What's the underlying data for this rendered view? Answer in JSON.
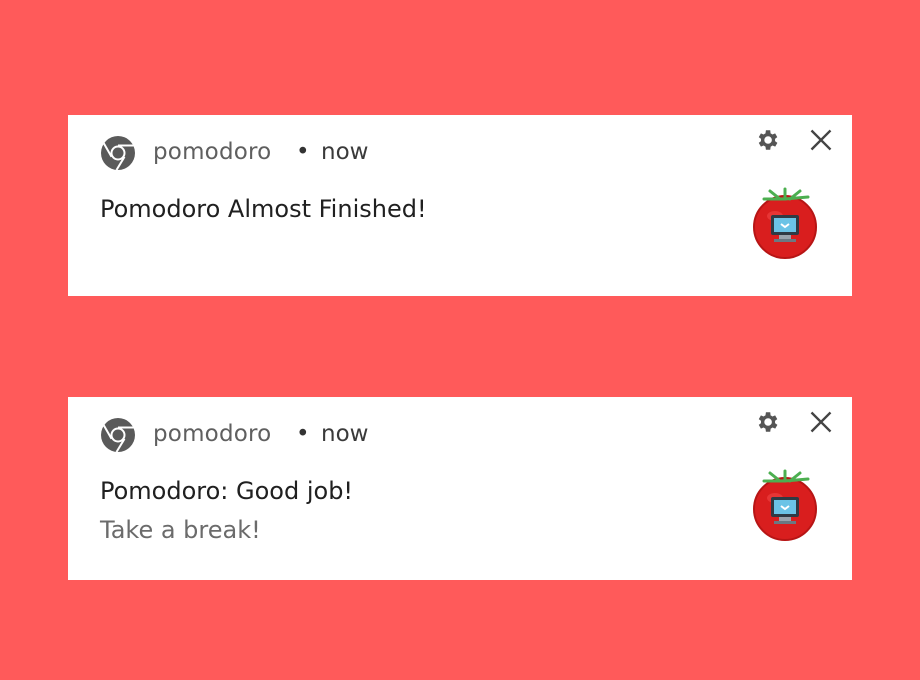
{
  "background_color": "#ff5a5a",
  "notifications": [
    {
      "app_name": "pomodoro",
      "separator": "•",
      "time": "now",
      "title": "Pomodoro Almost Finished!",
      "message": "",
      "icons": {
        "app": "chrome-icon",
        "settings": "gear-icon",
        "close": "close-icon",
        "image": "tomato-icon"
      }
    },
    {
      "app_name": "pomodoro",
      "separator": "•",
      "time": "now",
      "title": "Pomodoro: Good job!",
      "message": "Take a break!",
      "icons": {
        "app": "chrome-icon",
        "settings": "gear-icon",
        "close": "close-icon",
        "image": "tomato-icon"
      }
    }
  ]
}
